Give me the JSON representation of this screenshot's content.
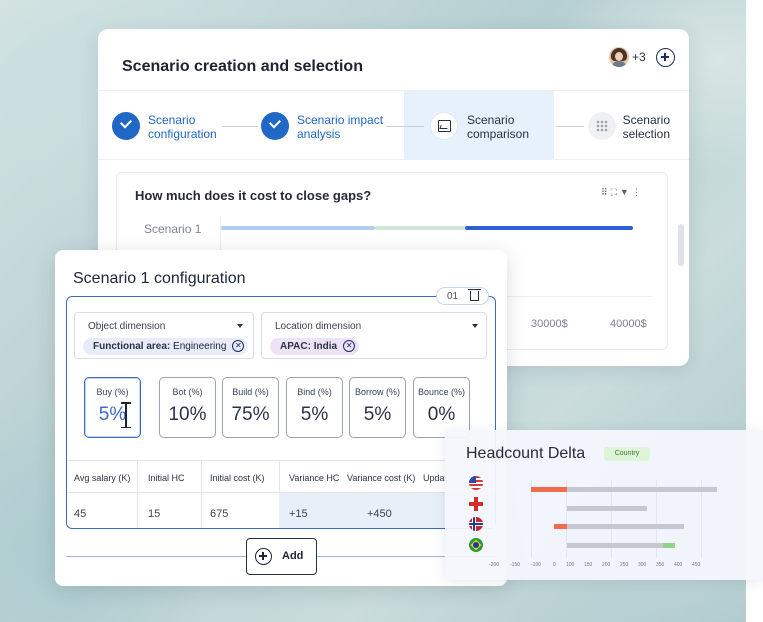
{
  "main": {
    "title": "Scenario creation and selection",
    "collaborators_extra": "+3",
    "steps": [
      {
        "line1": "Scenario",
        "line2": "configuration",
        "state": "done"
      },
      {
        "line1": "Scenario impact",
        "line2": "analysis",
        "state": "done"
      },
      {
        "line1": "Scenario",
        "line2": "comparison",
        "state": "active"
      },
      {
        "line1": "Scenario",
        "line2": "selection",
        "state": "pending"
      }
    ],
    "question": "How much does it cost to close gaps?",
    "scenario_label": "Scenario 1",
    "x_ticks": [
      "30000$",
      "40000$"
    ]
  },
  "config": {
    "title": "Scenario 1 configuration",
    "index": "01",
    "object_dimension": {
      "label": "Object dimension",
      "chip_key": "Functional area:",
      "chip_value": "Engineering"
    },
    "location_dimension": {
      "label": "Location dimension",
      "chip_value": "APAC: India"
    },
    "strategies": [
      {
        "label": "Buy (%)",
        "value": "5%"
      },
      {
        "label": "Bot (%)",
        "value": "10%"
      },
      {
        "label": "Build (%)",
        "value": "75%"
      },
      {
        "label": "Bind (%)",
        "value": "5%"
      },
      {
        "label": "Borrow (%)",
        "value": "5%"
      },
      {
        "label": "Bounce (%)",
        "value": "0%"
      }
    ],
    "table": {
      "headers": [
        "Avg salary (K)",
        "Initial HC",
        "Initial cost (K)",
        "Variance HC",
        "Variance cost (K)",
        "Updat"
      ],
      "row": [
        "45",
        "15",
        "675",
        "+15",
        "+450"
      ]
    },
    "add_label": "Add"
  },
  "headcount": {
    "title": "Headcount Delta",
    "badge": "Country",
    "x_ticks": [
      "-200",
      "-150",
      "-100",
      "0",
      "100",
      "150",
      "200",
      "250",
      "300",
      "350",
      "400",
      "450"
    ]
  },
  "colors": {
    "accent": "#2167c6",
    "step_highlight": "#e6f1fb",
    "bar_light_blue": "#b3cdf0",
    "bar_light_green": "#cfe8d4",
    "bar_dark_blue": "#2f5fd6",
    "hc_negative": "#f26b4d",
    "hc_neutral": "#c6c8d1",
    "hc_positive": "#8fd68a"
  }
}
